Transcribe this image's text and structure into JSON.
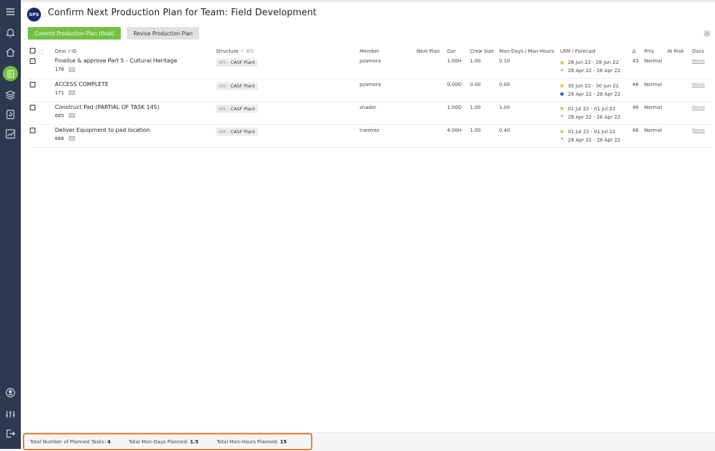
{
  "app": {
    "logo_text": "SPS",
    "title": "Confirm Next Production Plan for Team: Field Development"
  },
  "sidebar": {
    "items": [
      "menu-icon",
      "bell-icon",
      "home-icon",
      "plan-icon",
      "layers-icon",
      "refresh-doc-icon",
      "chart-icon",
      "user-icon",
      "sliders-icon",
      "logout-icon"
    ]
  },
  "toolbar": {
    "commit_label": "Commit Production Plan (final)",
    "revise_label": "Revise Production Plan"
  },
  "table": {
    "headers": {
      "desc": "Desc / ID",
      "structure": "Structure",
      "structure_ws": "WS",
      "member": "Member",
      "next_plan": "Next Plan",
      "dur": "Dur",
      "crew": "Crew Size",
      "mandays": "Man-Days / Man-Hours",
      "lrm": "LRM / Forecast",
      "delta": "Δ",
      "prty": "Prty",
      "atrisk": "At Risk",
      "docs": "Docs"
    },
    "rows": [
      {
        "desc": "Finalise & approve Part 5 - Cultural Heritage",
        "id": "176",
        "ws": "WS",
        "plant": "CASF Plant",
        "member": "pzamora",
        "next_plan": "",
        "dur": "1.00H",
        "crew": "1.00",
        "mandays": "0.10",
        "lrm": "28 Jun 22 - 28 Jun 22",
        "forecast": "28 Apr 22 - 28 Apr 22",
        "forecast_marker": "star",
        "delta": "43",
        "prty": "Normal",
        "atrisk": "",
        "docs": "None"
      },
      {
        "desc": "ACCESS COMPLETE",
        "id": "171",
        "ws": "WS",
        "plant": "CASF Plant",
        "member": "pzamora",
        "next_plan": "",
        "dur": "0.00D",
        "crew": "0.00",
        "mandays": "0.00",
        "lrm": "30 Jun 22 - 30 Jun 22",
        "forecast": "28 Apr 22 - 28 Apr 22",
        "forecast_marker": "dot",
        "delta": "46",
        "prty": "Normal",
        "atrisk": "",
        "docs": "None"
      },
      {
        "desc": "Construct Pad (PARTIAL OF TASK 145)",
        "id": "665",
        "ws": "WS",
        "plant": "CASF Plant",
        "member": "znader",
        "next_plan": "",
        "dur": "1.00D",
        "crew": "1.00",
        "mandays": "1.00",
        "lrm": "01 Jul 22 - 01 Jul 22",
        "forecast": "28 Apr 22 - 28 Apr 22",
        "forecast_marker": "star",
        "delta": "46",
        "prty": "Normal",
        "atrisk": "",
        "docs": "None"
      },
      {
        "desc": "Deliver Equipment to pad location",
        "id": "666",
        "ws": "WS",
        "plant": "CASF Plant",
        "member": "lramirez",
        "next_plan": "",
        "dur": "4.00H",
        "crew": "1.00",
        "mandays": "0.40",
        "lrm": "01 Jul 22 - 01 Jul 22",
        "forecast": "28 Apr 22 - 28 Apr 22",
        "forecast_marker": "star",
        "delta": "46",
        "prty": "Normal",
        "atrisk": "",
        "docs": "None"
      }
    ]
  },
  "footer": {
    "tasks_label": "Total Number of Planned Tasks:",
    "tasks_value": "4",
    "mandays_label": "Total Man-Days Planned:",
    "mandays_value": "1.5",
    "manhours_label": "Total Man-Hours Planned:",
    "manhours_value": "15"
  },
  "colors": {
    "sidebar": "#2b3a4e",
    "accent_green": "#74c043",
    "lrm_dot": "#f2c14a",
    "forecast_dot": "#3a5cc4",
    "footer_highlight": "#e0803c"
  }
}
